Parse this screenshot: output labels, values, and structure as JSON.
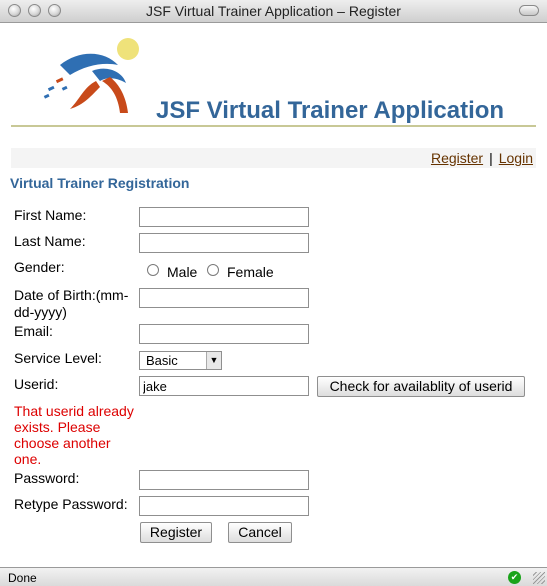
{
  "window": {
    "title": "JSF Virtual Trainer Application – Register"
  },
  "app": {
    "title": "JSF Virtual Trainer Application"
  },
  "nav": {
    "register": "Register",
    "separator": "|",
    "login": "Login"
  },
  "form": {
    "heading": "Virtual Trainer Registration",
    "first_name_label": "First Name:",
    "first_name_value": "",
    "last_name_label": "Last Name:",
    "last_name_value": "",
    "gender_label": "Gender:",
    "gender_male": "Male",
    "gender_female": "Female",
    "dob_label": "Date of Birth:(mm-dd-yyyy)",
    "dob_value": "",
    "email_label": "Email:",
    "email_value": "",
    "service_level_label": "Service Level:",
    "service_level_value": "Basic",
    "userid_label": "Userid:",
    "userid_value": "jake",
    "check_button": "Check for availablity of userid",
    "error_message": "That userid already exists. Please choose another one.",
    "password_label": "Password:",
    "password_value": "",
    "retype_password_label": "Retype Password:",
    "retype_password_value": "",
    "register_button": "Register",
    "cancel_button": "Cancel"
  },
  "status": {
    "text": "Done"
  },
  "colors": {
    "heading": "#336699",
    "link": "#663300",
    "error": "#dd0000"
  }
}
